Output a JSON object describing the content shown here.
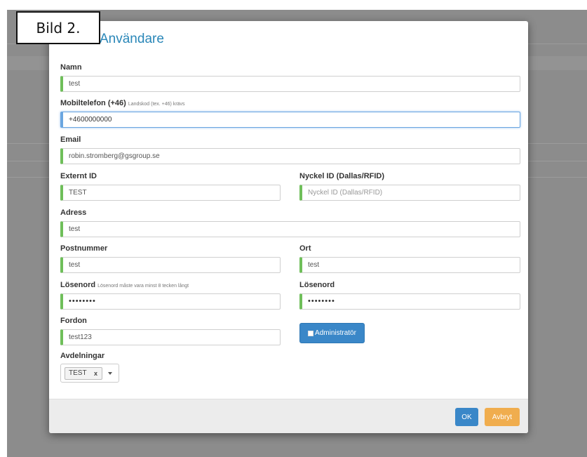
{
  "overlay_label": "Bild 2.",
  "dialog": {
    "title": "Användare"
  },
  "form": {
    "namn": {
      "label": "Namn",
      "value": "test"
    },
    "mobil": {
      "label": "Mobiltelefon (+46)",
      "hint": "Landskod (tex. +46) krävs",
      "value": "+4600000000"
    },
    "email": {
      "label": "Email",
      "value": "robin.stromberg@gsgroup.se"
    },
    "externt_id": {
      "label": "Externt ID",
      "value": "TEST"
    },
    "nyckel_id": {
      "label": "Nyckel ID (Dallas/RFID)",
      "placeholder": "Nyckel ID (Dallas/RFID)"
    },
    "adress": {
      "label": "Adress",
      "value": "test"
    },
    "postnummer": {
      "label": "Postnummer",
      "value": "test"
    },
    "ort": {
      "label": "Ort",
      "value": "test"
    },
    "losenord": {
      "label": "Lösenord",
      "hint": "Lösenord måste vara minst 8 tecken långt",
      "value": "••••••••"
    },
    "losenord2": {
      "label": "Lösenord",
      "value": "••••••••"
    },
    "fordon": {
      "label": "Fordon",
      "value": "test123"
    },
    "administrator": {
      "label": "Administratör"
    },
    "avdelningar": {
      "label": "Avdelningar",
      "tags": [
        "TEST"
      ],
      "remove": "x"
    }
  },
  "footer": {
    "ok": "OK",
    "cancel": "Avbryt"
  },
  "colors": {
    "title": "#2a87b8",
    "valid_border": "#6fbf5a",
    "focus_border": "#6aa6e0",
    "primary": "#3a87c8",
    "warning": "#f0ad4e"
  }
}
